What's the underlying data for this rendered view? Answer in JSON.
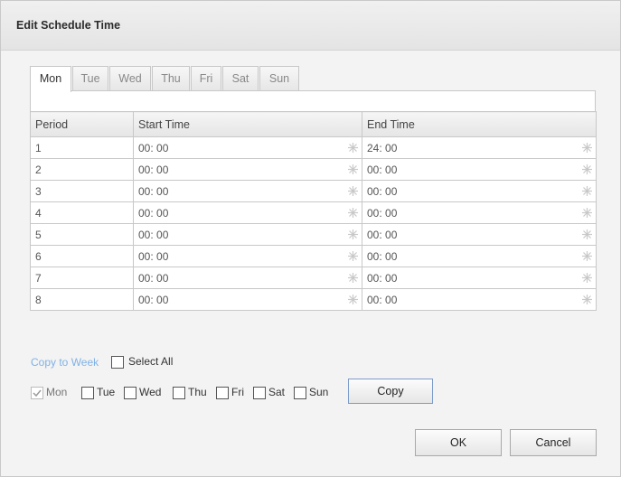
{
  "dialog": {
    "title": "Edit Schedule Time"
  },
  "tabs": [
    {
      "label": "Mon",
      "active": true
    },
    {
      "label": "Tue",
      "active": false
    },
    {
      "label": "Wed",
      "active": false
    },
    {
      "label": "Thu",
      "active": false
    },
    {
      "label": "Fri",
      "active": false
    },
    {
      "label": "Sat",
      "active": false
    },
    {
      "label": "Sun",
      "active": false
    }
  ],
  "table": {
    "headers": {
      "period": "Period",
      "start": "Start Time",
      "end": "End Time"
    },
    "rows": [
      {
        "period": "1",
        "start": "00: 00",
        "end": "24: 00"
      },
      {
        "period": "2",
        "start": "00: 00",
        "end": "00: 00"
      },
      {
        "period": "3",
        "start": "00: 00",
        "end": "00: 00"
      },
      {
        "period": "4",
        "start": "00: 00",
        "end": "00: 00"
      },
      {
        "period": "5",
        "start": "00: 00",
        "end": "00: 00"
      },
      {
        "period": "6",
        "start": "00: 00",
        "end": "00: 00"
      },
      {
        "period": "7",
        "start": "00: 00",
        "end": "00: 00"
      },
      {
        "period": "8",
        "start": "00: 00",
        "end": "00: 00"
      }
    ],
    "picker_icon": "time-picker-icon"
  },
  "copy": {
    "link_label": "Copy to Week",
    "select_all_label": "Select All",
    "days": [
      {
        "label": "Mon",
        "checked": true
      },
      {
        "label": "Tue",
        "checked": false
      },
      {
        "label": "Wed",
        "checked": false
      },
      {
        "label": "Thu",
        "checked": false
      },
      {
        "label": "Fri",
        "checked": false
      },
      {
        "label": "Sat",
        "checked": false
      },
      {
        "label": "Sun",
        "checked": false
      }
    ],
    "button_label": "Copy"
  },
  "footer": {
    "ok_label": "OK",
    "cancel_label": "Cancel"
  },
  "colors": {
    "link": "#7fb2e6",
    "border": "#c8c8c8",
    "copy_border": "#7b9cc9"
  }
}
